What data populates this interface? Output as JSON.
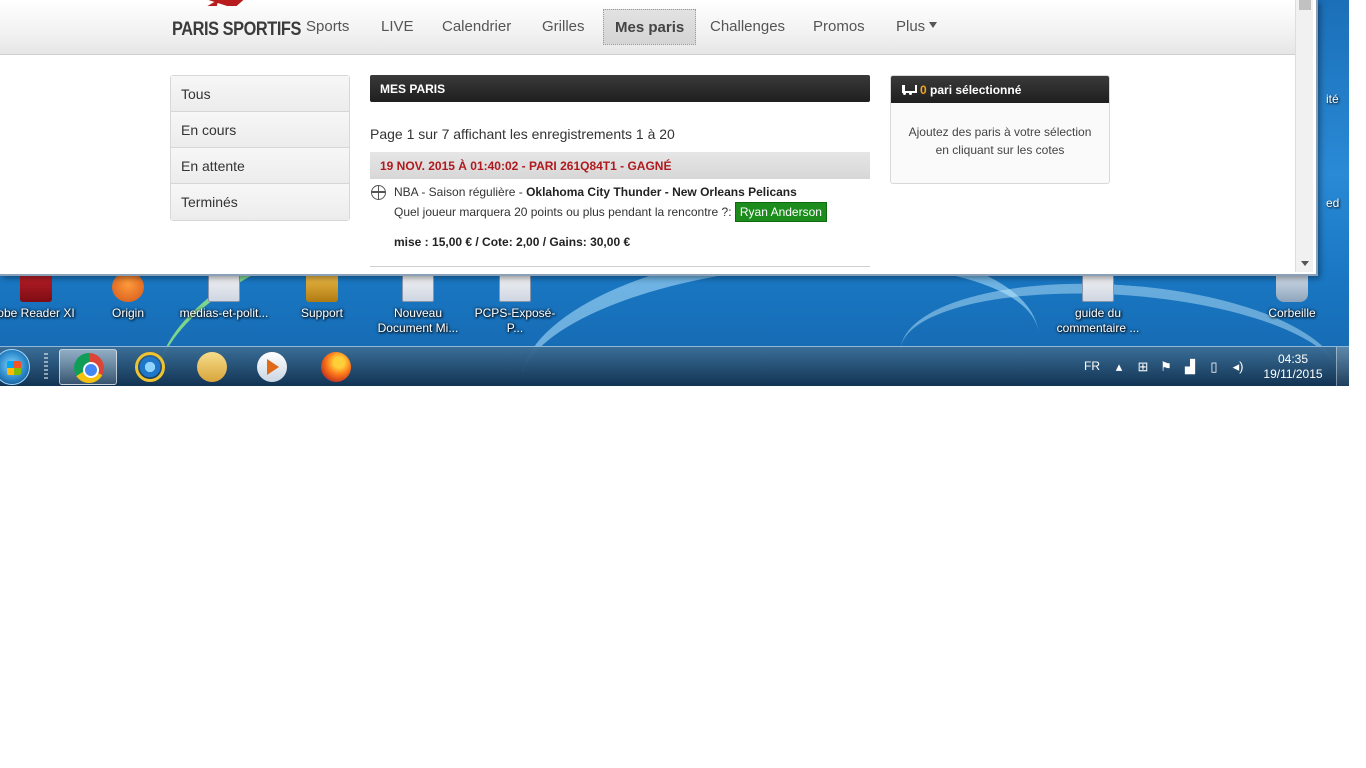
{
  "browser": {
    "brand": "PARIS SPORTIFS",
    "nav": [
      {
        "label": "Sports"
      },
      {
        "label": "LIVE"
      },
      {
        "label": "Calendrier"
      },
      {
        "label": "Grilles"
      },
      {
        "label": "Mes paris"
      },
      {
        "label": "Challenges"
      },
      {
        "label": "Promos"
      },
      {
        "label": "Plus"
      }
    ],
    "active_nav": "Mes paris",
    "side_menu": [
      {
        "label": "Tous"
      },
      {
        "label": "En cours"
      },
      {
        "label": "En attente"
      },
      {
        "label": "Terminés"
      }
    ],
    "main": {
      "header": "MES PARIS",
      "paging": "Page 1 sur 7 affichant les enregistrements 1 à 20",
      "bet": {
        "title": "19 NOV. 2015 À 01:40:02 - PARI 261Q84T1 - GAGNÉ",
        "competition": "NBA - Saison régulière - ",
        "match": "Oklahoma City Thunder - New Orleans Pelicans",
        "question": "Quel joueur marquera 20 points ou plus pendant la rencontre ?: ",
        "pick": "Ryan Anderson",
        "stake": "mise : 15,00 € / Cote: 2,00 / Gains: 30,00 €"
      }
    },
    "cart": {
      "count": "0",
      "label": " pari sélectionné",
      "message": "Ajoutez des paris à votre sélection en cliquant sur les cotes"
    }
  },
  "desktop": {
    "icons": [
      {
        "label": "obe Reader XI",
        "icon": "pdf-icon"
      },
      {
        "label": "Origin",
        "icon": "origin-icon"
      },
      {
        "label": "medias-et-polit...",
        "icon": "document-icon"
      },
      {
        "label": "Support",
        "icon": "support-icon"
      },
      {
        "label": "Nouveau Document Mi...",
        "icon": "document-icon"
      },
      {
        "label": "PCPS-Exposé-P...",
        "icon": "document-icon"
      },
      {
        "label": "guide du commentaire ...",
        "icon": "document-icon"
      },
      {
        "label": "Corbeille",
        "icon": "recycle-bin-icon"
      }
    ],
    "right_cut_1": "ité",
    "right_cut_2": "ed"
  },
  "taskbar": {
    "apps": [
      "chrome-icon",
      "internet-explorer-icon",
      "file-explorer-icon",
      "media-player-icon",
      "firefox-icon"
    ],
    "language": "FR",
    "time": "04:35",
    "date": "19/11/2015"
  }
}
